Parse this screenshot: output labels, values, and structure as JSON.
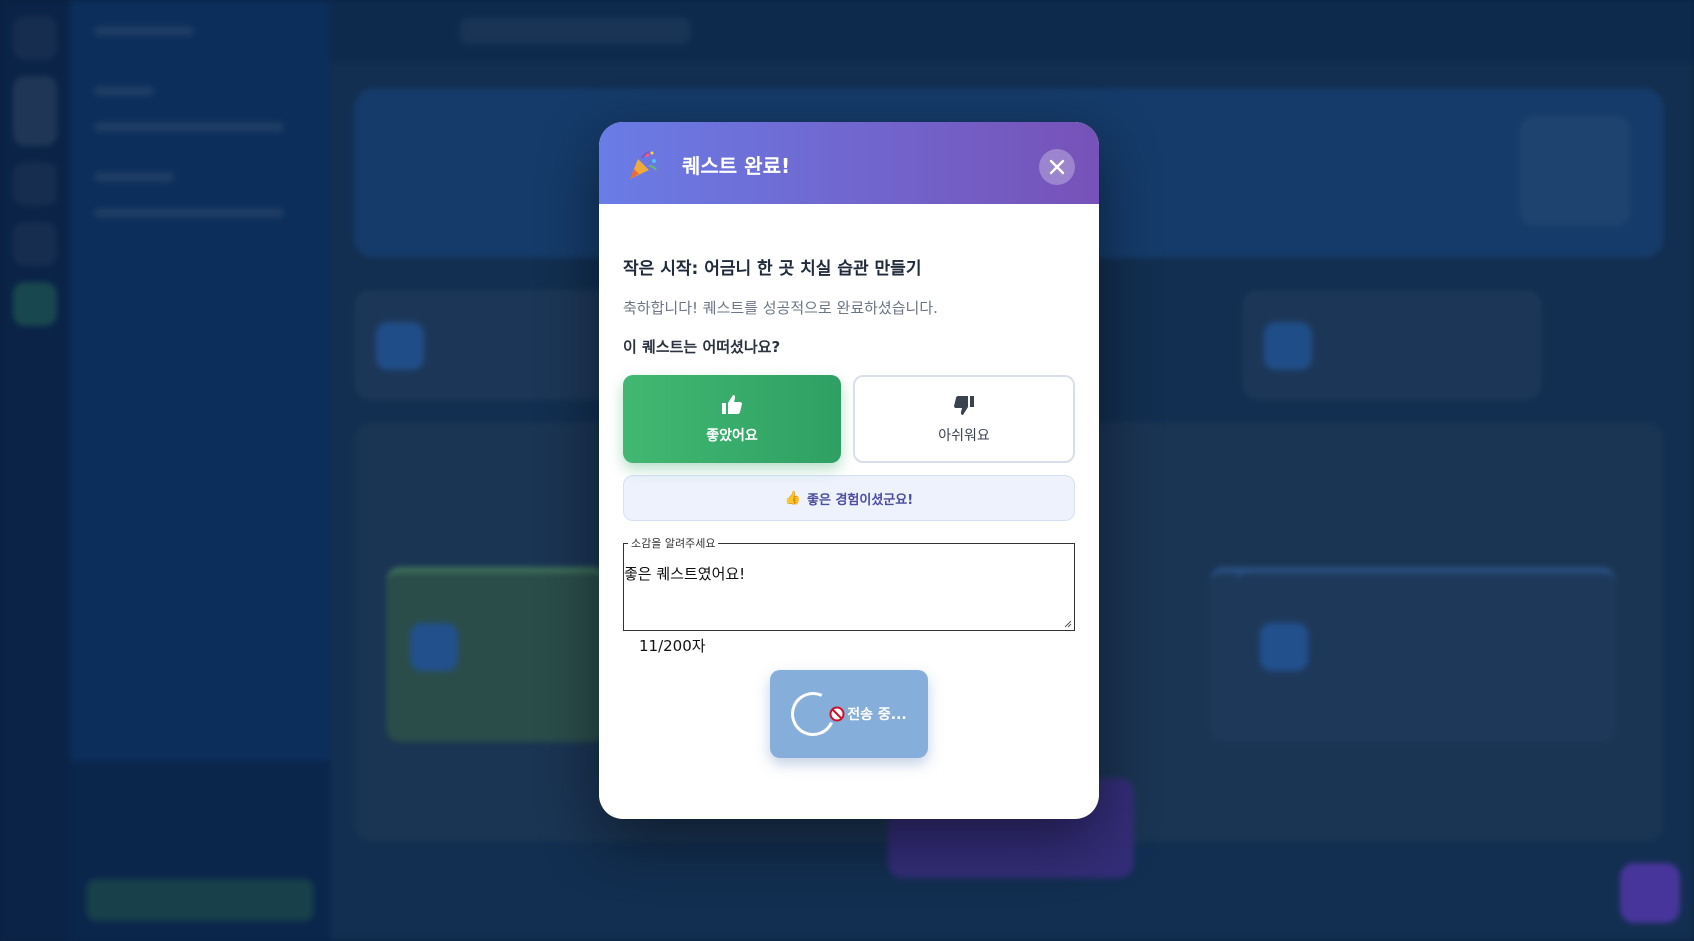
{
  "modal": {
    "title": "퀘스트 완료!",
    "quest_name": "작은 시작: 어금니 한 곳 치실 습관 만들기",
    "congrats": "축하합니다! 퀘스트를 성공적으로 완료하셨습니다.",
    "question": "이 퀘스트는 어떠셨나요?",
    "good_label": "좋았어요",
    "bad_label": "아쉬워요",
    "selected_rating": "good",
    "feedback_icon": "👍",
    "feedback_message": "좋은 경험이셨군요!",
    "note_legend": "소감을 알려주세요",
    "note_value": "좋은 퀘스트였어요!",
    "char_count": "11/200자",
    "submit_label": "전송 중..."
  },
  "colors": {
    "header_start": "#6a7ce6",
    "header_end": "#7752b8",
    "good": "#41b872",
    "submit_disabled": "#86aeda"
  }
}
